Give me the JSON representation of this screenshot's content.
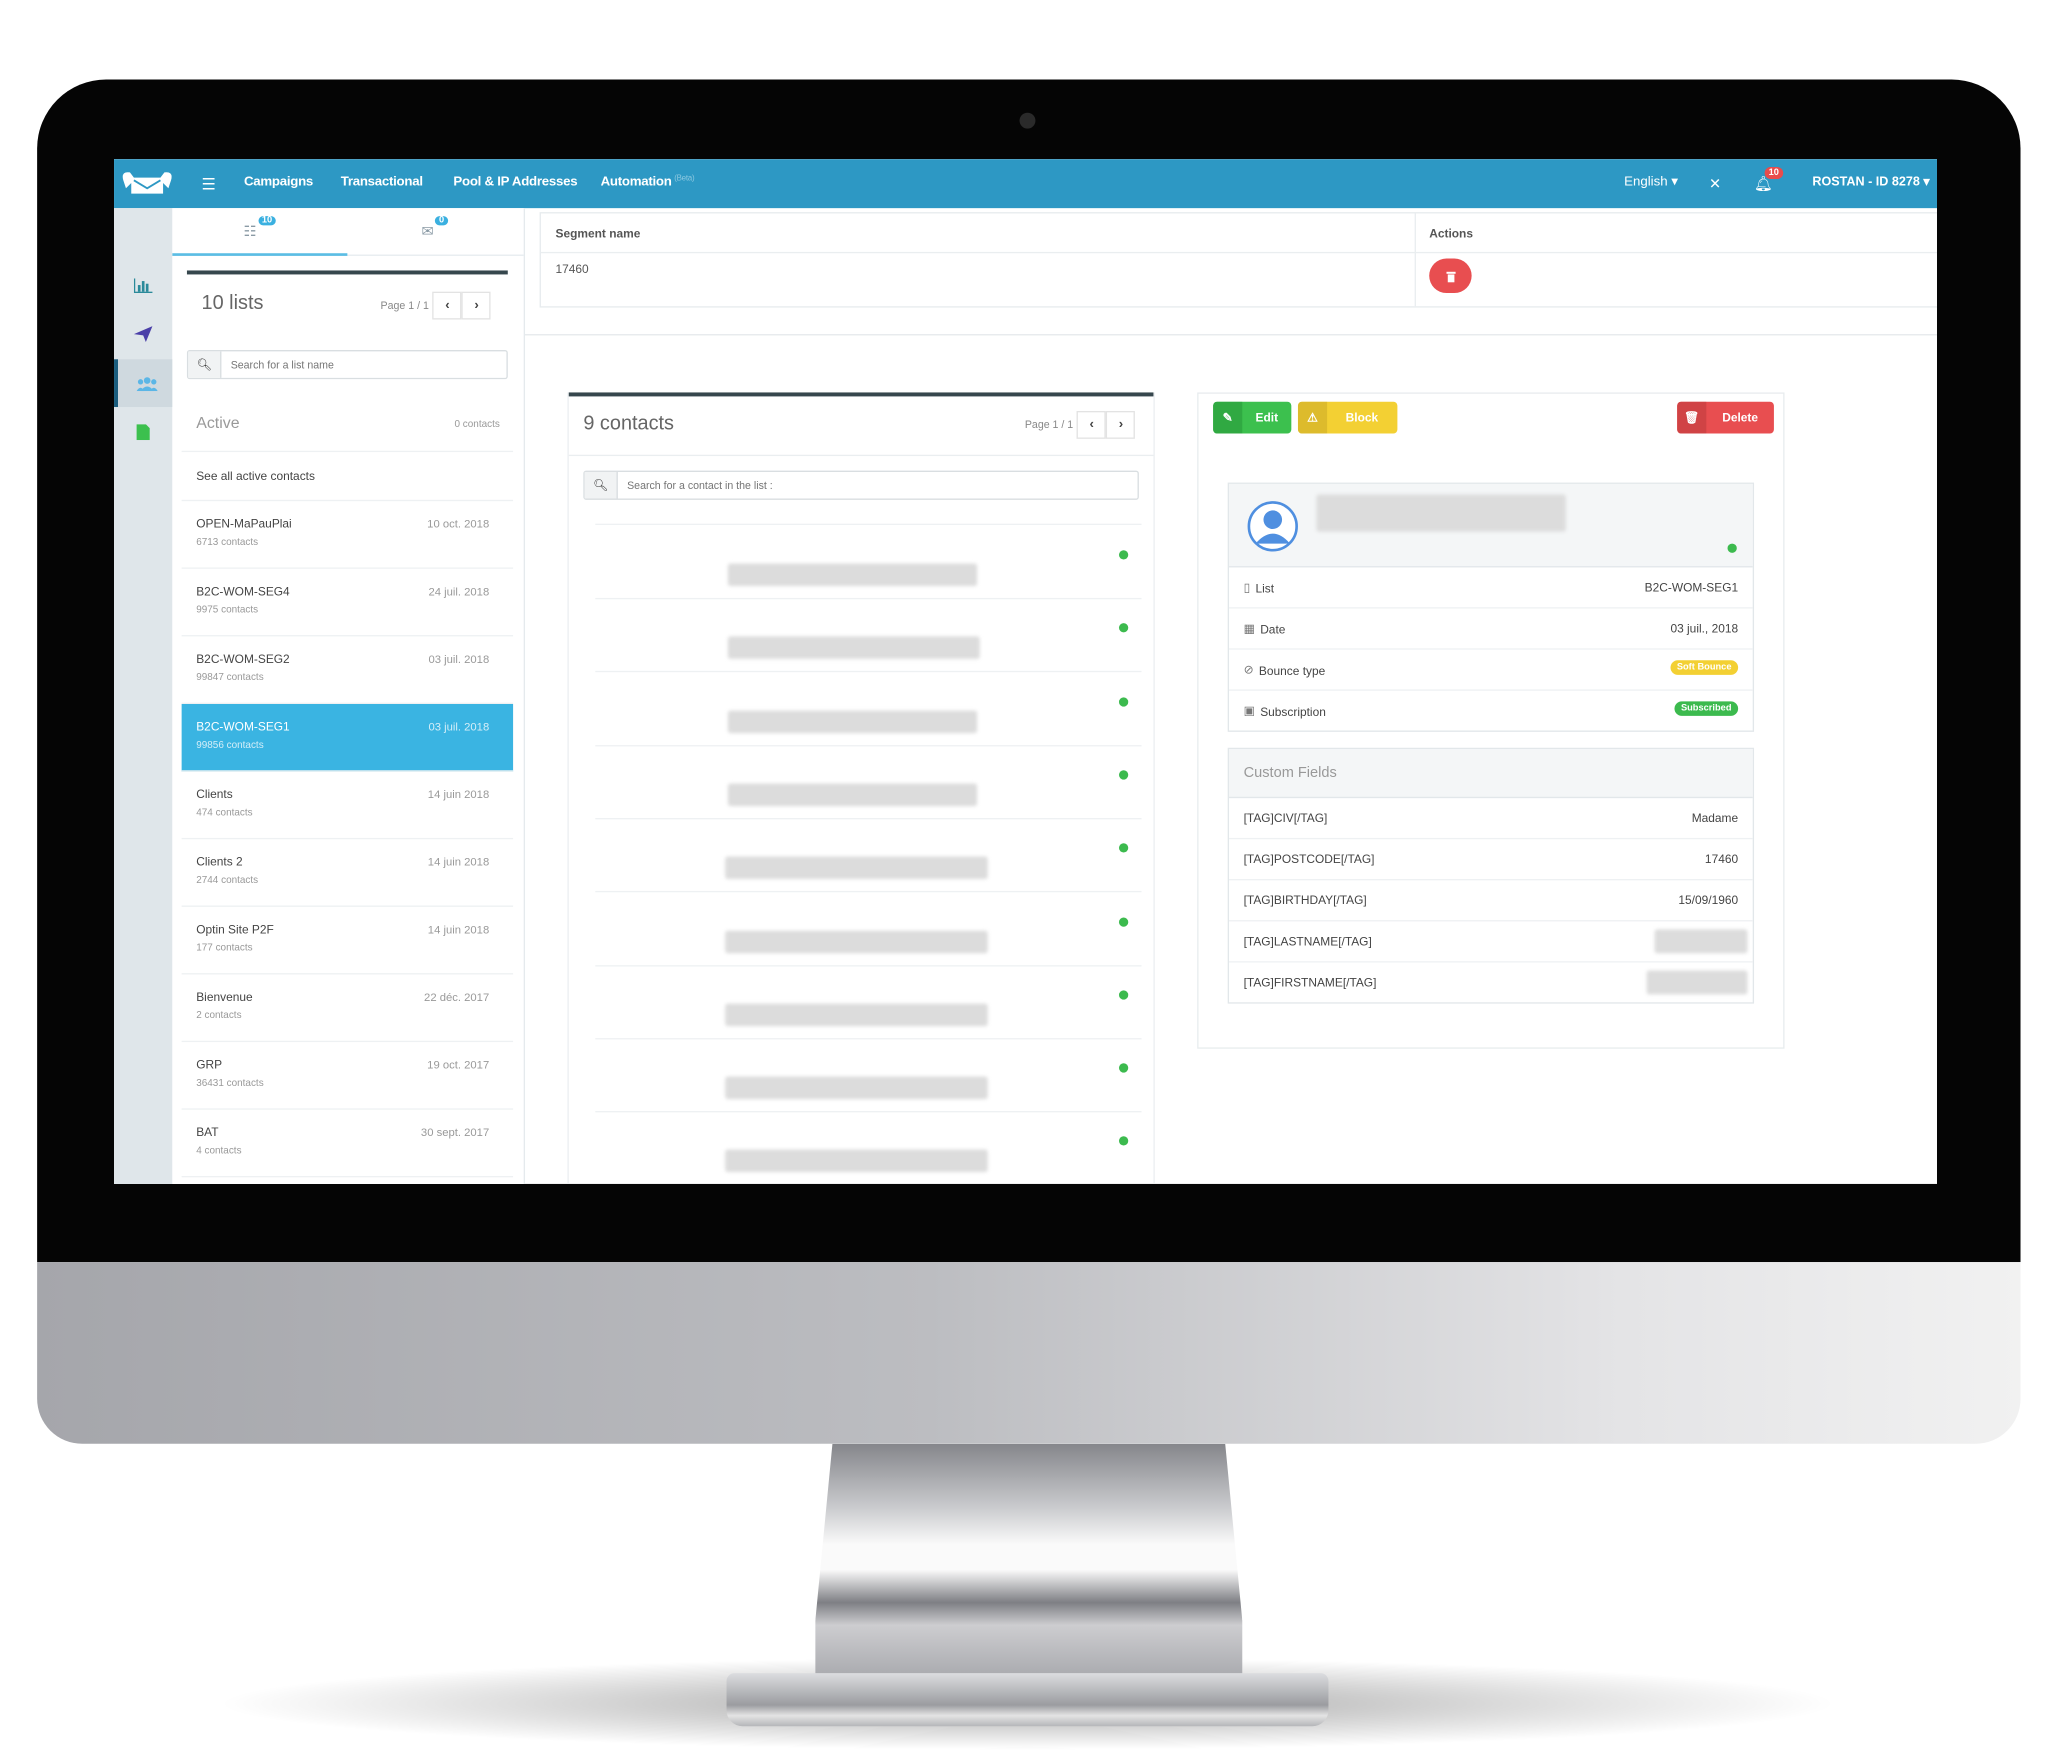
{
  "colors": {
    "topbar": "#2d98c4",
    "accent": "#3ab4e2",
    "success": "#3cba4e",
    "warning": "#f3d033",
    "danger": "#e84e50"
  },
  "topbar": {
    "logo": "mail-muscle-logo",
    "menu_icon": "menu-icon",
    "nav": [
      {
        "label": "Campaigns"
      },
      {
        "label": "Transactional"
      },
      {
        "label": "Pool & IP Addresses"
      },
      {
        "label": "Automation",
        "tag": "(Beta)"
      }
    ],
    "language": "English ▾",
    "pin_icon": "pin-icon",
    "notifications_count": "10",
    "user_label": "ROSTAN - ID 8278 ▾"
  },
  "sidebar": {
    "items": [
      {
        "icon": "bar-chart-icon",
        "active": false
      },
      {
        "icon": "paper-plane-icon",
        "active": false
      },
      {
        "icon": "users-icon",
        "active": true
      },
      {
        "icon": "file-icon",
        "active": false
      }
    ]
  },
  "lists_panel": {
    "tabs": [
      {
        "icon": "list-icon",
        "badge": "10"
      },
      {
        "icon": "inbox-icon",
        "badge": "0"
      }
    ],
    "title": "10 lists",
    "pager": "Page 1 / 1",
    "search_placeholder": "Search for a list name",
    "active_label": "Active",
    "active_count": "0 contacts",
    "see_all": "See all active contacts",
    "items": [
      {
        "name": "OPEN-MaPauPlai",
        "count": "6713 contacts",
        "date": "10 oct. 2018"
      },
      {
        "name": "B2C-WOM-SEG4",
        "count": "9975 contacts",
        "date": "24 juil. 2018"
      },
      {
        "name": "B2C-WOM-SEG2",
        "count": "99847 contacts",
        "date": "03 juil. 2018"
      },
      {
        "name": "B2C-WOM-SEG1",
        "count": "99856 contacts",
        "date": "03 juil. 2018",
        "selected": true
      },
      {
        "name": "Clients",
        "count": "474 contacts",
        "date": "14 juin 2018"
      },
      {
        "name": "Clients 2",
        "count": "2744 contacts",
        "date": "14 juin 2018"
      },
      {
        "name": "Optin Site P2F",
        "count": "177 contacts",
        "date": "14 juin 2018"
      },
      {
        "name": "Bienvenue",
        "count": "2 contacts",
        "date": "22 déc. 2017"
      },
      {
        "name": "GRP",
        "count": "36431 contacts",
        "date": "19 oct. 2017"
      },
      {
        "name": "BAT",
        "count": "4 contacts",
        "date": "30 sept. 2017"
      }
    ]
  },
  "segments": {
    "headers": [
      "Segment name",
      "Actions"
    ],
    "rows": [
      {
        "name": "17460"
      }
    ]
  },
  "contacts_panel": {
    "title": "9 contacts",
    "pager": "Page 1 / 1",
    "search_placeholder": "Search for a contact in the list :",
    "rows": [
      {
        "email": "[redacted]",
        "status": "active"
      },
      {
        "email": "[redacted]",
        "status": "active"
      },
      {
        "email": "[redacted]",
        "status": "active"
      },
      {
        "email": "[redacted]",
        "status": "active"
      },
      {
        "email": "[redacted]",
        "status": "active"
      },
      {
        "email": "[redacted]",
        "status": "active"
      },
      {
        "email": "[redacted]",
        "status": "active"
      },
      {
        "email": "[redacted]",
        "status": "active"
      },
      {
        "email": "[redacted]",
        "status": "active"
      }
    ]
  },
  "detail": {
    "buttons": {
      "edit": "Edit",
      "block": "Block",
      "delete": "Delete"
    },
    "email": "[redacted]",
    "fields": [
      {
        "icon": "book-icon",
        "label": "List",
        "value": "B2C-WOM-SEG1"
      },
      {
        "icon": "calendar-icon",
        "label": "Date",
        "value": "03 juil., 2018"
      },
      {
        "icon": "ban-icon",
        "label": "Bounce type",
        "badge": "Soft Bounce"
      },
      {
        "icon": "rss-icon",
        "label": "Subscription",
        "badge": "Subscribed"
      }
    ],
    "custom_fields_title": "Custom Fields",
    "custom_fields": [
      {
        "label": "[TAG]CIV[/TAG]",
        "value": "Madame"
      },
      {
        "label": "[TAG]POSTCODE[/TAG]",
        "value": "17460"
      },
      {
        "label": "[TAG]BIRTHDAY[/TAG]",
        "value": "15/09/1960"
      },
      {
        "label": "[TAG]LASTNAME[/TAG]",
        "value": "[redacted]"
      },
      {
        "label": "[TAG]FIRSTNAME[/TAG]",
        "value": "[redacted]"
      }
    ]
  }
}
